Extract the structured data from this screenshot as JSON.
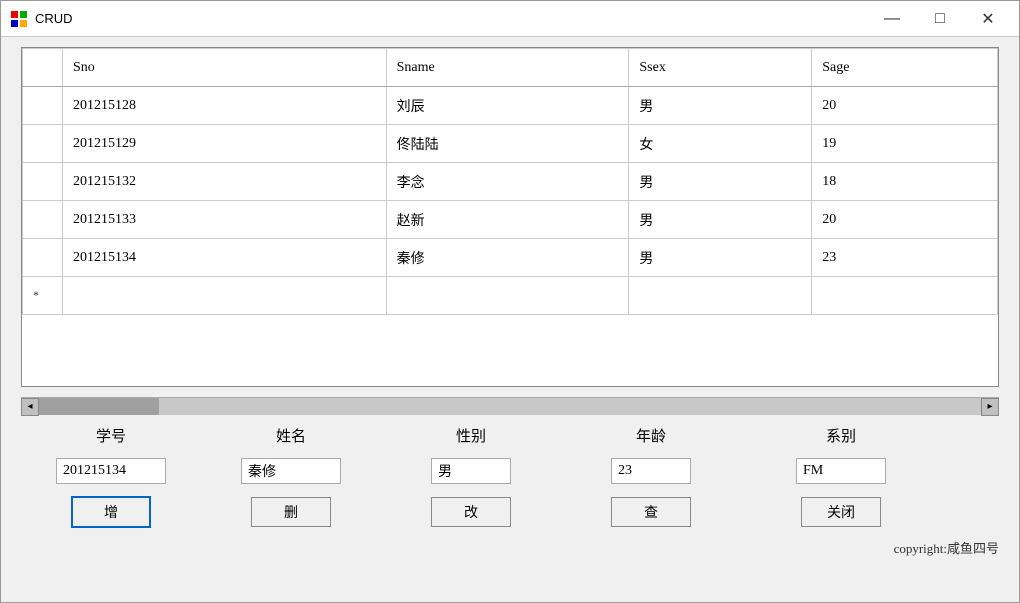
{
  "window": {
    "title": "CRUD",
    "minimize_label": "—",
    "maximize_label": "□",
    "close_label": "✕"
  },
  "table": {
    "columns": [
      {
        "id": "marker",
        "label": ""
      },
      {
        "id": "sno",
        "label": "Sno"
      },
      {
        "id": "sname",
        "label": "Sname"
      },
      {
        "id": "ssex",
        "label": "Ssex"
      },
      {
        "id": "sage",
        "label": "Sage"
      }
    ],
    "rows": [
      {
        "marker": "",
        "sno": "201215128",
        "sname": "刘辰",
        "ssex": "男",
        "sage": "20"
      },
      {
        "marker": "",
        "sno": "201215129",
        "sname": "佟陆陆",
        "ssex": "女",
        "sage": "19"
      },
      {
        "marker": "",
        "sno": "201215132",
        "sname": "李念",
        "ssex": "男",
        "sage": "18"
      },
      {
        "marker": "",
        "sno": "201215133",
        "sname": "赵新",
        "ssex": "男",
        "sage": "20"
      },
      {
        "marker": "",
        "sno": "201215134",
        "sname": "秦修",
        "ssex": "男",
        "sage": "23"
      },
      {
        "marker": "*",
        "sno": "",
        "sname": "",
        "ssex": "",
        "sage": ""
      }
    ]
  },
  "form": {
    "labels": {
      "sno": "学号",
      "sname": "姓名",
      "ssex": "性别",
      "sage": "年龄",
      "sdept": "系别"
    },
    "values": {
      "sno": "201215134",
      "sname": "秦修",
      "ssex": "男",
      "sage": "23",
      "sdept": "FM"
    },
    "placeholders": {
      "sno": "",
      "sname": "",
      "ssex": "",
      "sage": "",
      "sdept": ""
    },
    "buttons": {
      "add": "增",
      "delete": "删",
      "modify": "改",
      "query": "查",
      "close": "关闭"
    }
  },
  "copyright": "copyright:咸鱼四号"
}
